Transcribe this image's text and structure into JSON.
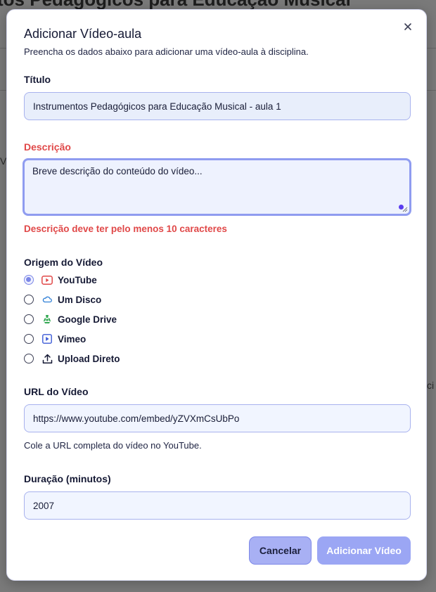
{
  "background": {
    "title": "tos Pedagógicos para Educação Musical",
    "side_left": "V",
    "side_right": "ci"
  },
  "modal": {
    "title": "Adicionar Vídeo-aula",
    "subtitle": "Preencha os dados abaixo para adicionar uma vídeo-aula à disciplina.",
    "close_icon": "close-icon"
  },
  "form": {
    "titulo": {
      "label": "Título",
      "value": "Instrumentos Pedagógicos para Educação Musical - aula 1"
    },
    "descricao": {
      "label": "Descrição",
      "placeholder": "Breve descrição do conteúdo do vídeo...",
      "error": "Descrição deve ter pelo menos 10 caracteres"
    },
    "origem": {
      "label": "Origem do Vídeo",
      "selected": "YouTube",
      "options": [
        {
          "label": "YouTube",
          "icon": "youtube-icon",
          "color": "#e04848",
          "checked": true
        },
        {
          "label": "Um Disco",
          "icon": "cloud-icon",
          "color": "#2f7fd6",
          "checked": false
        },
        {
          "label": "Google Drive",
          "icon": "google-drive-icon",
          "color": "#34a853",
          "checked": false
        },
        {
          "label": "Vimeo",
          "icon": "vimeo-icon",
          "color": "#3b5ad6",
          "checked": false
        },
        {
          "label": "Upload Direto",
          "icon": "upload-icon",
          "color": "#151934",
          "checked": false
        }
      ]
    },
    "url": {
      "label": "URL do Vídeo",
      "value": "https://www.youtube.com/embed/yZVXmCsUbPo",
      "helper": "Cole a URL completa do vídeo no YouTube."
    },
    "duracao": {
      "label": "Duração (minutos)",
      "value": "2007"
    }
  },
  "actions": {
    "cancel_label": "Cancelar",
    "submit_label": "Adicionar Vídeo"
  },
  "colors": {
    "accent": "#7b86e6",
    "error": "#e04848",
    "input_bg": "#e8eefb"
  }
}
